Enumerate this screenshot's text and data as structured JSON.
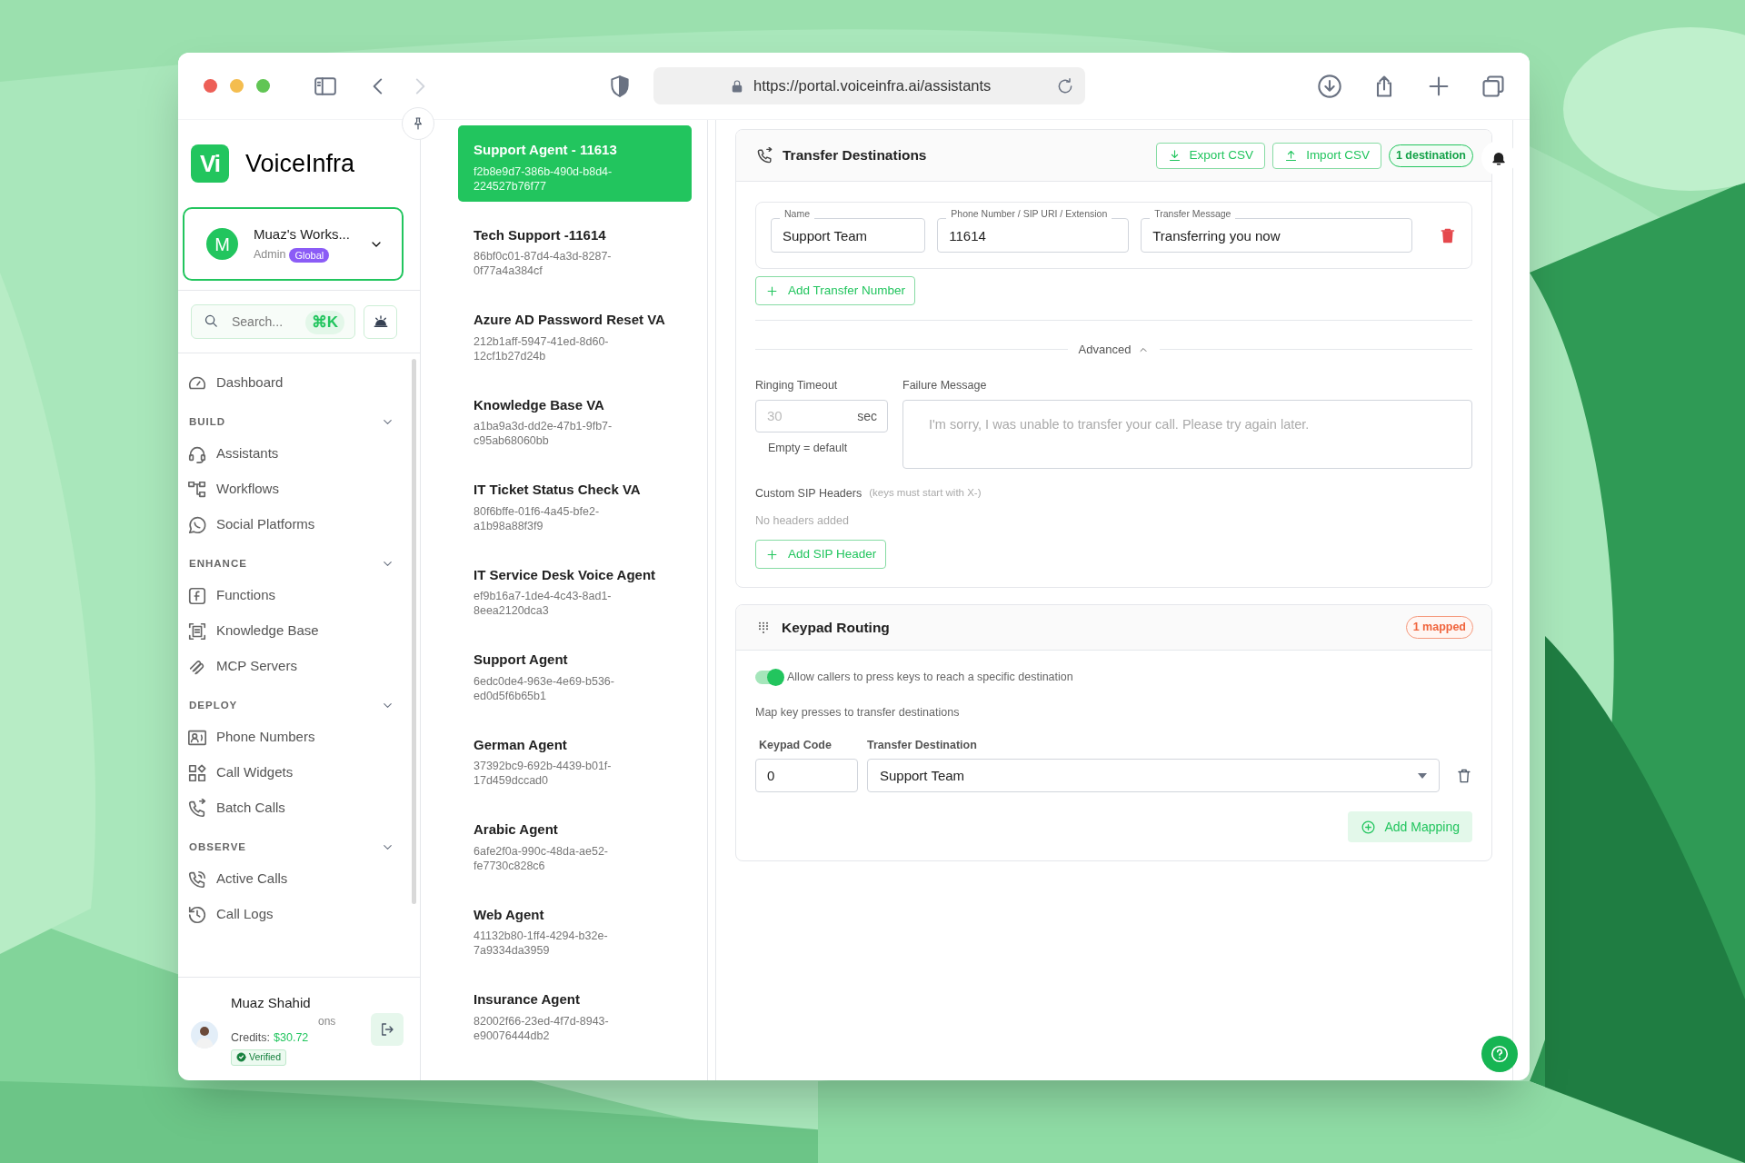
{
  "browser": {
    "url": "https://portal.voiceinfra.ai/assistants"
  },
  "sidebar": {
    "brand": {
      "logo": "Vi",
      "name": "VoiceInfra"
    },
    "workspace": {
      "initial": "M",
      "name": "Muaz's Works...",
      "role": "Admin",
      "badge": "Global"
    },
    "search": {
      "placeholder": "Search...",
      "shortcut": "⌘K"
    },
    "nav": [
      {
        "kind": "item",
        "label": "Dashboard"
      },
      {
        "kind": "section",
        "label": "BUILD"
      },
      {
        "kind": "item",
        "label": "Assistants"
      },
      {
        "kind": "item",
        "label": "Workflows"
      },
      {
        "kind": "item",
        "label": "Social Platforms"
      },
      {
        "kind": "section",
        "label": "ENHANCE"
      },
      {
        "kind": "item",
        "label": "Functions"
      },
      {
        "kind": "item",
        "label": "Knowledge Base"
      },
      {
        "kind": "item",
        "label": "MCP Servers"
      },
      {
        "kind": "section",
        "label": "DEPLOY"
      },
      {
        "kind": "item",
        "label": "Phone Numbers"
      },
      {
        "kind": "item",
        "label": "Call Widgets"
      },
      {
        "kind": "item",
        "label": "Batch Calls"
      },
      {
        "kind": "section",
        "label": "OBSERVE"
      },
      {
        "kind": "item",
        "label": "Active Calls"
      },
      {
        "kind": "item",
        "label": "Call Logs"
      }
    ],
    "user": {
      "name": "Muaz Shahid",
      "subtitle_fragment": "ons",
      "credits_label": "Credits:",
      "credits": "$30.72",
      "badge": "Verified"
    }
  },
  "assistants": [
    {
      "name": "Support Agent - 11613",
      "id": "f2b8e9d7-386b-490d-b8d4-224527b76f77",
      "selected": true
    },
    {
      "name": "Tech Support -11614",
      "id": "86bf0c01-87d4-4a3d-8287-0f77a4a384cf",
      "selected": false
    },
    {
      "name": "Azure AD Password Reset VA",
      "id": "212b1aff-5947-41ed-8d60-12cf1b27d24b",
      "selected": false
    },
    {
      "name": "Knowledge Base VA",
      "id": "a1ba9a3d-dd2e-47b1-9fb7-c95ab68060bb",
      "selected": false
    },
    {
      "name": "IT Ticket Status Check VA",
      "id": "80f6bffe-01f6-4a45-bfe2-a1b98a88f3f9",
      "selected": false
    },
    {
      "name": "IT Service Desk Voice Agent",
      "id": "ef9b16a7-1de4-4c43-8ad1-8eea2120dca3",
      "selected": false
    },
    {
      "name": "Support Agent",
      "id": "6edc0de4-963e-4e69-b536-ed0d5f6b65b1",
      "selected": false
    },
    {
      "name": "German Agent",
      "id": "37392bc9-692b-4439-b01f-17d459dccad0",
      "selected": false
    },
    {
      "name": "Arabic Agent",
      "id": "6afe2f0a-990c-48da-ae52-fe7730c828c6",
      "selected": false
    },
    {
      "name": "Web Agent",
      "id": "41132b80-1ff4-4294-b32e-7a9334da3959",
      "selected": false
    },
    {
      "name": "Insurance Agent",
      "id": "82002f66-23ed-4f7d-8943-e90076444db2",
      "selected": false
    }
  ],
  "transfer_destinations": {
    "title": "Transfer Destinations",
    "export_button": "Export CSV",
    "import_button": "Import CSV",
    "count_badge": "1 destination",
    "entries": [
      {
        "name_label": "Name",
        "name": "Support Team",
        "number_label": "Phone Number / SIP URI / Extension",
        "number": "11614",
        "message_label": "Transfer Message",
        "message": "Transferring you now"
      }
    ],
    "add_button": "Add Transfer Number",
    "advanced": {
      "label": "Advanced",
      "expanded": true
    },
    "ringing_timeout": {
      "label": "Ringing Timeout",
      "placeholder": "30",
      "unit": "sec",
      "hint": "Empty = default"
    },
    "failure_message": {
      "label": "Failure Message",
      "placeholder": "I'm sorry, I was unable to transfer your call. Please try again later."
    },
    "sip_headers": {
      "label": "Custom SIP Headers",
      "hint": "(keys must start with X-)",
      "empty": "No headers added",
      "add_button": "Add SIP Header"
    }
  },
  "keypad_routing": {
    "title": "Keypad Routing",
    "badge": "1 mapped",
    "toggle": {
      "label": "Allow callers to press keys to reach a specific destination",
      "on": true
    },
    "subtitle": "Map key presses to transfer destinations",
    "columns": [
      "Keypad Code",
      "Transfer Destination"
    ],
    "mappings": [
      {
        "code": "0",
        "destination": "Support Team"
      }
    ],
    "add_button": "Add Mapping"
  }
}
